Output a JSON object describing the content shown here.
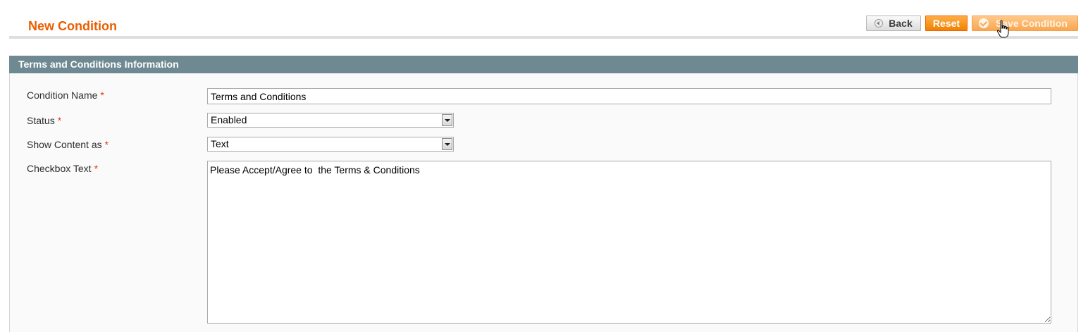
{
  "page": {
    "title": "New Condition"
  },
  "buttons": {
    "back": "Back",
    "reset": "Reset",
    "save": "Save Condition"
  },
  "section": {
    "title": "Terms and Conditions Information"
  },
  "form": {
    "condition_name": {
      "label": "Condition Name",
      "required_mark": "*",
      "value": "Terms and Conditions"
    },
    "status": {
      "label": "Status",
      "required_mark": "*",
      "value": "Enabled"
    },
    "show_content_as": {
      "label": "Show Content as",
      "required_mark": "*",
      "value": "Text"
    },
    "checkbox_text": {
      "label": "Checkbox Text",
      "required_mark": "*",
      "value": "Please Accept/Agree to  the Terms & Conditions"
    }
  },
  "colors": {
    "title": "#eb5e00",
    "section_header_bg": "#6f8992",
    "primary_button": "#f18200",
    "required": "#eb340a"
  },
  "icons": {
    "back": "back-arrow-icon",
    "save": "check-icon",
    "cursor": "hand-pointer-icon",
    "select_arrow": "chevron-down-icon"
  }
}
